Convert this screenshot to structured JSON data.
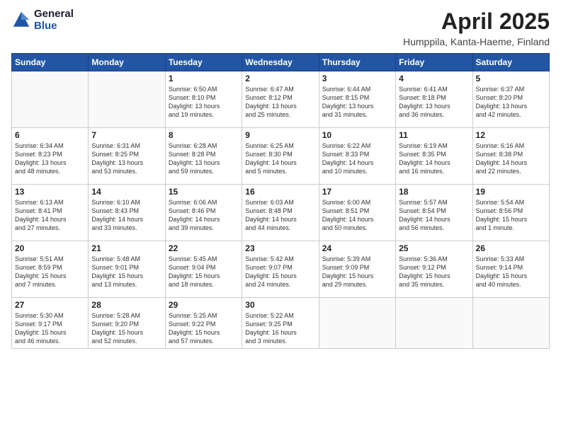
{
  "header": {
    "logo": {
      "general": "General",
      "blue": "Blue"
    },
    "title": "April 2025",
    "location": "Humppila, Kanta-Haeme, Finland"
  },
  "weekdays": [
    "Sunday",
    "Monday",
    "Tuesday",
    "Wednesday",
    "Thursday",
    "Friday",
    "Saturday"
  ],
  "weeks": [
    [
      {
        "day": null,
        "info": null
      },
      {
        "day": null,
        "info": null
      },
      {
        "day": "1",
        "info": "Sunrise: 6:50 AM\nSunset: 8:10 PM\nDaylight: 13 hours\nand 19 minutes."
      },
      {
        "day": "2",
        "info": "Sunrise: 6:47 AM\nSunset: 8:12 PM\nDaylight: 13 hours\nand 25 minutes."
      },
      {
        "day": "3",
        "info": "Sunrise: 6:44 AM\nSunset: 8:15 PM\nDaylight: 13 hours\nand 31 minutes."
      },
      {
        "day": "4",
        "info": "Sunrise: 6:41 AM\nSunset: 8:18 PM\nDaylight: 13 hours\nand 36 minutes."
      },
      {
        "day": "5",
        "info": "Sunrise: 6:37 AM\nSunset: 8:20 PM\nDaylight: 13 hours\nand 42 minutes."
      }
    ],
    [
      {
        "day": "6",
        "info": "Sunrise: 6:34 AM\nSunset: 8:23 PM\nDaylight: 13 hours\nand 48 minutes."
      },
      {
        "day": "7",
        "info": "Sunrise: 6:31 AM\nSunset: 8:25 PM\nDaylight: 13 hours\nand 53 minutes."
      },
      {
        "day": "8",
        "info": "Sunrise: 6:28 AM\nSunset: 8:28 PM\nDaylight: 13 hours\nand 59 minutes."
      },
      {
        "day": "9",
        "info": "Sunrise: 6:25 AM\nSunset: 8:30 PM\nDaylight: 14 hours\nand 5 minutes."
      },
      {
        "day": "10",
        "info": "Sunrise: 6:22 AM\nSunset: 8:33 PM\nDaylight: 14 hours\nand 10 minutes."
      },
      {
        "day": "11",
        "info": "Sunrise: 6:19 AM\nSunset: 8:35 PM\nDaylight: 14 hours\nand 16 minutes."
      },
      {
        "day": "12",
        "info": "Sunrise: 6:16 AM\nSunset: 8:38 PM\nDaylight: 14 hours\nand 22 minutes."
      }
    ],
    [
      {
        "day": "13",
        "info": "Sunrise: 6:13 AM\nSunset: 8:41 PM\nDaylight: 14 hours\nand 27 minutes."
      },
      {
        "day": "14",
        "info": "Sunrise: 6:10 AM\nSunset: 8:43 PM\nDaylight: 14 hours\nand 33 minutes."
      },
      {
        "day": "15",
        "info": "Sunrise: 6:06 AM\nSunset: 8:46 PM\nDaylight: 14 hours\nand 39 minutes."
      },
      {
        "day": "16",
        "info": "Sunrise: 6:03 AM\nSunset: 8:48 PM\nDaylight: 14 hours\nand 44 minutes."
      },
      {
        "day": "17",
        "info": "Sunrise: 6:00 AM\nSunset: 8:51 PM\nDaylight: 14 hours\nand 50 minutes."
      },
      {
        "day": "18",
        "info": "Sunrise: 5:57 AM\nSunset: 8:54 PM\nDaylight: 14 hours\nand 56 minutes."
      },
      {
        "day": "19",
        "info": "Sunrise: 5:54 AM\nSunset: 8:56 PM\nDaylight: 15 hours\nand 1 minute."
      }
    ],
    [
      {
        "day": "20",
        "info": "Sunrise: 5:51 AM\nSunset: 8:59 PM\nDaylight: 15 hours\nand 7 minutes."
      },
      {
        "day": "21",
        "info": "Sunrise: 5:48 AM\nSunset: 9:01 PM\nDaylight: 15 hours\nand 13 minutes."
      },
      {
        "day": "22",
        "info": "Sunrise: 5:45 AM\nSunset: 9:04 PM\nDaylight: 15 hours\nand 18 minutes."
      },
      {
        "day": "23",
        "info": "Sunrise: 5:42 AM\nSunset: 9:07 PM\nDaylight: 15 hours\nand 24 minutes."
      },
      {
        "day": "24",
        "info": "Sunrise: 5:39 AM\nSunset: 9:09 PM\nDaylight: 15 hours\nand 29 minutes."
      },
      {
        "day": "25",
        "info": "Sunrise: 5:36 AM\nSunset: 9:12 PM\nDaylight: 15 hours\nand 35 minutes."
      },
      {
        "day": "26",
        "info": "Sunrise: 5:33 AM\nSunset: 9:14 PM\nDaylight: 15 hours\nand 40 minutes."
      }
    ],
    [
      {
        "day": "27",
        "info": "Sunrise: 5:30 AM\nSunset: 9:17 PM\nDaylight: 15 hours\nand 46 minutes."
      },
      {
        "day": "28",
        "info": "Sunrise: 5:28 AM\nSunset: 9:20 PM\nDaylight: 15 hours\nand 52 minutes."
      },
      {
        "day": "29",
        "info": "Sunrise: 5:25 AM\nSunset: 9:22 PM\nDaylight: 15 hours\nand 57 minutes."
      },
      {
        "day": "30",
        "info": "Sunrise: 5:22 AM\nSunset: 9:25 PM\nDaylight: 16 hours\nand 3 minutes."
      },
      {
        "day": null,
        "info": null
      },
      {
        "day": null,
        "info": null
      },
      {
        "day": null,
        "info": null
      }
    ]
  ]
}
